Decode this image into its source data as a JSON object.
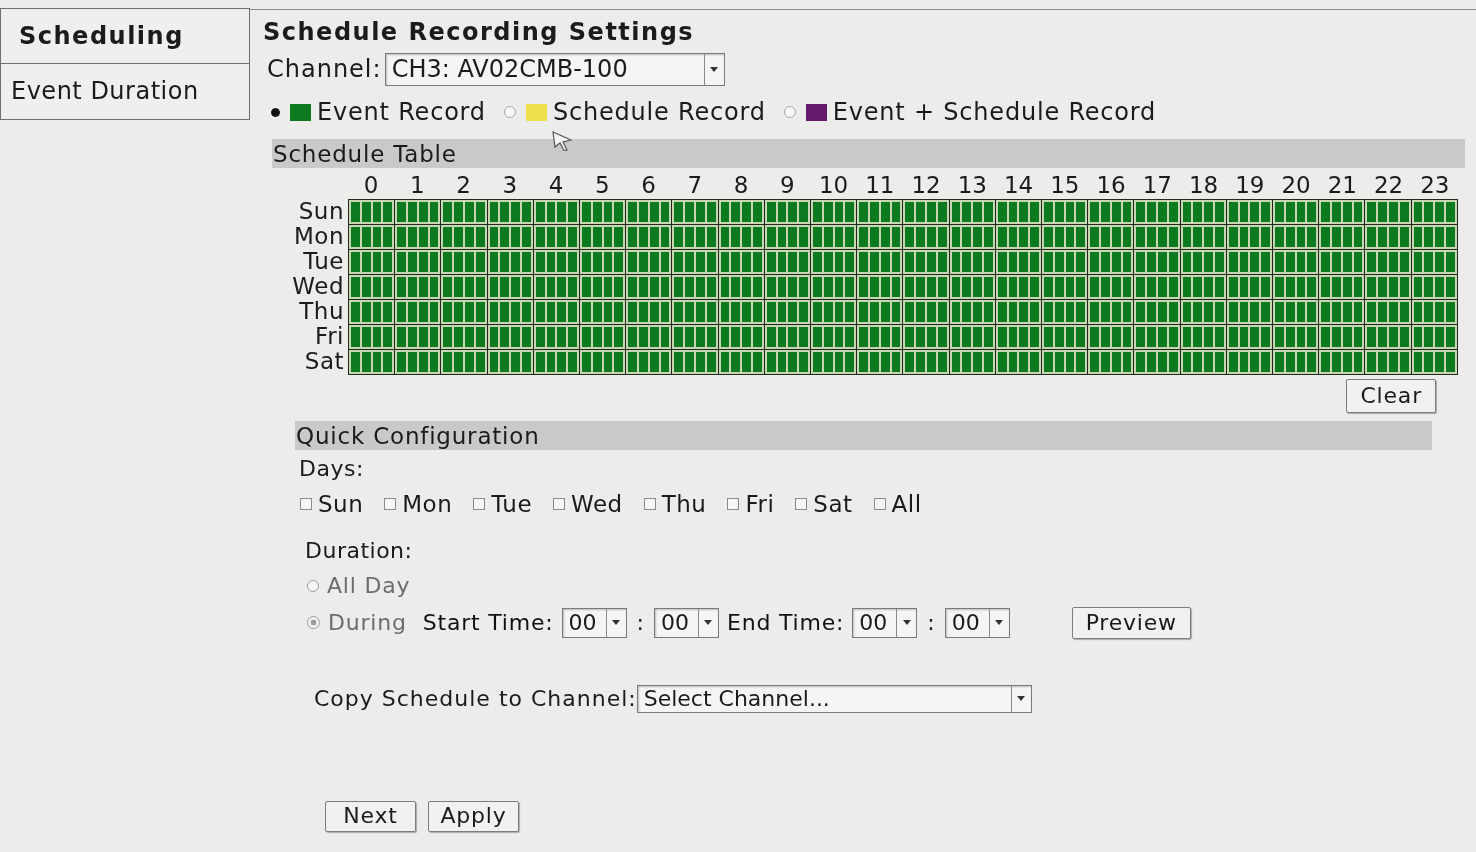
{
  "sidebar": {
    "tabs": [
      {
        "label": "Scheduling",
        "selected": true
      },
      {
        "label": "Event Duration",
        "selected": false
      }
    ]
  },
  "title": "Schedule Recording Settings",
  "channel": {
    "label": "Channel:",
    "value": "CH3: AV02CMB-100"
  },
  "modes": [
    {
      "kind": "event",
      "label": "Event Record",
      "color": "#0d7a1f",
      "selected": true
    },
    {
      "kind": "schedule",
      "label": "Schedule Record",
      "color": "#f0df4c",
      "selected": false
    },
    {
      "kind": "event_schedule",
      "label": "Event + Schedule Record",
      "color": "#651a6b",
      "selected": false
    }
  ],
  "schedule": {
    "title": "Schedule Table",
    "hours": [
      "0",
      "1",
      "2",
      "3",
      "4",
      "5",
      "6",
      "7",
      "8",
      "9",
      "10",
      "11",
      "12",
      "13",
      "14",
      "15",
      "16",
      "17",
      "18",
      "19",
      "20",
      "21",
      "22",
      "23"
    ],
    "days": [
      {
        "label": "Sun",
        "slots": [
          {
            "kind": "event"
          },
          {
            "kind": "event"
          },
          {
            "kind": "event"
          },
          {
            "kind": "event"
          },
          {
            "kind": "event"
          },
          {
            "kind": "event"
          },
          {
            "kind": "event"
          },
          {
            "kind": "event"
          },
          {
            "kind": "event"
          },
          {
            "kind": "event"
          },
          {
            "kind": "event"
          },
          {
            "kind": "event"
          },
          {
            "kind": "event"
          },
          {
            "kind": "event"
          },
          {
            "kind": "event"
          },
          {
            "kind": "event"
          },
          {
            "kind": "event"
          },
          {
            "kind": "event"
          },
          {
            "kind": "event"
          },
          {
            "kind": "event"
          },
          {
            "kind": "event"
          },
          {
            "kind": "event"
          },
          {
            "kind": "event"
          },
          {
            "kind": "event"
          },
          {
            "kind": "event"
          },
          {
            "kind": "event"
          },
          {
            "kind": "event"
          },
          {
            "kind": "event"
          },
          {
            "kind": "event"
          },
          {
            "kind": "event"
          },
          {
            "kind": "event"
          },
          {
            "kind": "event"
          },
          {
            "kind": "event"
          },
          {
            "kind": "event"
          },
          {
            "kind": "event"
          },
          {
            "kind": "event"
          },
          {
            "kind": "event"
          },
          {
            "kind": "event"
          },
          {
            "kind": "event"
          },
          {
            "kind": "event"
          },
          {
            "kind": "event"
          },
          {
            "kind": "event"
          },
          {
            "kind": "event"
          },
          {
            "kind": "event"
          },
          {
            "kind": "event"
          },
          {
            "kind": "event"
          },
          {
            "kind": "event"
          },
          {
            "kind": "event"
          },
          {
            "kind": "event"
          },
          {
            "kind": "event"
          },
          {
            "kind": "event"
          },
          {
            "kind": "event"
          },
          {
            "kind": "event"
          },
          {
            "kind": "event"
          },
          {
            "kind": "event"
          },
          {
            "kind": "event"
          },
          {
            "kind": "event"
          },
          {
            "kind": "event"
          },
          {
            "kind": "event"
          },
          {
            "kind": "event"
          },
          {
            "kind": "event"
          },
          {
            "kind": "event"
          },
          {
            "kind": "event"
          },
          {
            "kind": "event"
          },
          {
            "kind": "event"
          },
          {
            "kind": "event"
          },
          {
            "kind": "event"
          },
          {
            "kind": "event"
          },
          {
            "kind": "event"
          },
          {
            "kind": "event"
          },
          {
            "kind": "event"
          },
          {
            "kind": "event"
          },
          {
            "kind": "event"
          },
          {
            "kind": "event"
          },
          {
            "kind": "event"
          },
          {
            "kind": "event"
          },
          {
            "kind": "event"
          },
          {
            "kind": "event"
          },
          {
            "kind": "event"
          },
          {
            "kind": "event"
          },
          {
            "kind": "event"
          },
          {
            "kind": "event"
          },
          {
            "kind": "event"
          },
          {
            "kind": "event"
          },
          {
            "kind": "event"
          },
          {
            "kind": "event"
          },
          {
            "kind": "event"
          },
          {
            "kind": "event"
          },
          {
            "kind": "event"
          },
          {
            "kind": "event"
          },
          {
            "kind": "event"
          },
          {
            "kind": "event"
          },
          {
            "kind": "event"
          },
          {
            "kind": "event"
          },
          {
            "kind": "event"
          },
          {
            "kind": "event"
          }
        ]
      },
      {
        "label": "Mon",
        "slots": [
          {
            "kind": "event"
          },
          {
            "kind": "event"
          },
          {
            "kind": "event"
          },
          {
            "kind": "event"
          },
          {
            "kind": "event"
          },
          {
            "kind": "event"
          },
          {
            "kind": "event"
          },
          {
            "kind": "event"
          },
          {
            "kind": "event"
          },
          {
            "kind": "event"
          },
          {
            "kind": "event"
          },
          {
            "kind": "event"
          },
          {
            "kind": "event"
          },
          {
            "kind": "event"
          },
          {
            "kind": "event"
          },
          {
            "kind": "event"
          },
          {
            "kind": "event"
          },
          {
            "kind": "event"
          },
          {
            "kind": "event"
          },
          {
            "kind": "event"
          },
          {
            "kind": "event"
          },
          {
            "kind": "event"
          },
          {
            "kind": "event"
          },
          {
            "kind": "event"
          },
          {
            "kind": "event"
          },
          {
            "kind": "event"
          },
          {
            "kind": "event"
          },
          {
            "kind": "event"
          },
          {
            "kind": "event"
          },
          {
            "kind": "event"
          },
          {
            "kind": "event"
          },
          {
            "kind": "event"
          },
          {
            "kind": "event"
          },
          {
            "kind": "event"
          },
          {
            "kind": "event"
          },
          {
            "kind": "event"
          },
          {
            "kind": "event"
          },
          {
            "kind": "event"
          },
          {
            "kind": "event"
          },
          {
            "kind": "event"
          },
          {
            "kind": "event"
          },
          {
            "kind": "event"
          },
          {
            "kind": "event"
          },
          {
            "kind": "event"
          },
          {
            "kind": "event"
          },
          {
            "kind": "event"
          },
          {
            "kind": "event"
          },
          {
            "kind": "event"
          },
          {
            "kind": "event"
          },
          {
            "kind": "event"
          },
          {
            "kind": "event"
          },
          {
            "kind": "event"
          },
          {
            "kind": "event"
          },
          {
            "kind": "event"
          },
          {
            "kind": "event"
          },
          {
            "kind": "event"
          },
          {
            "kind": "event"
          },
          {
            "kind": "event"
          },
          {
            "kind": "event"
          },
          {
            "kind": "event"
          },
          {
            "kind": "event"
          },
          {
            "kind": "event"
          },
          {
            "kind": "event"
          },
          {
            "kind": "event"
          },
          {
            "kind": "event"
          },
          {
            "kind": "event"
          },
          {
            "kind": "event"
          },
          {
            "kind": "event"
          },
          {
            "kind": "event"
          },
          {
            "kind": "event"
          },
          {
            "kind": "event"
          },
          {
            "kind": "event"
          },
          {
            "kind": "event"
          },
          {
            "kind": "event"
          },
          {
            "kind": "event"
          },
          {
            "kind": "event"
          },
          {
            "kind": "event"
          },
          {
            "kind": "event"
          },
          {
            "kind": "event"
          },
          {
            "kind": "event"
          },
          {
            "kind": "event"
          },
          {
            "kind": "event"
          },
          {
            "kind": "event"
          },
          {
            "kind": "event"
          },
          {
            "kind": "event"
          },
          {
            "kind": "event"
          },
          {
            "kind": "event"
          },
          {
            "kind": "event"
          },
          {
            "kind": "event"
          },
          {
            "kind": "event"
          },
          {
            "kind": "event"
          },
          {
            "kind": "event"
          },
          {
            "kind": "event"
          },
          {
            "kind": "event"
          },
          {
            "kind": "event"
          },
          {
            "kind": "event"
          }
        ]
      },
      {
        "label": "Tue",
        "slots": [
          {
            "kind": "event"
          },
          {
            "kind": "event"
          },
          {
            "kind": "event"
          },
          {
            "kind": "event"
          },
          {
            "kind": "event"
          },
          {
            "kind": "event"
          },
          {
            "kind": "event"
          },
          {
            "kind": "event"
          },
          {
            "kind": "event"
          },
          {
            "kind": "event"
          },
          {
            "kind": "event"
          },
          {
            "kind": "event"
          },
          {
            "kind": "event"
          },
          {
            "kind": "event"
          },
          {
            "kind": "event"
          },
          {
            "kind": "event"
          },
          {
            "kind": "event"
          },
          {
            "kind": "event"
          },
          {
            "kind": "event"
          },
          {
            "kind": "event"
          },
          {
            "kind": "event"
          },
          {
            "kind": "event"
          },
          {
            "kind": "event"
          },
          {
            "kind": "event"
          },
          {
            "kind": "event"
          },
          {
            "kind": "event"
          },
          {
            "kind": "event"
          },
          {
            "kind": "event"
          },
          {
            "kind": "event"
          },
          {
            "kind": "event"
          },
          {
            "kind": "event"
          },
          {
            "kind": "event"
          },
          {
            "kind": "event"
          },
          {
            "kind": "event"
          },
          {
            "kind": "event"
          },
          {
            "kind": "event"
          },
          {
            "kind": "event"
          },
          {
            "kind": "event"
          },
          {
            "kind": "event"
          },
          {
            "kind": "event"
          },
          {
            "kind": "event"
          },
          {
            "kind": "event"
          },
          {
            "kind": "event"
          },
          {
            "kind": "event"
          },
          {
            "kind": "event"
          },
          {
            "kind": "event"
          },
          {
            "kind": "event"
          },
          {
            "kind": "event"
          },
          {
            "kind": "event"
          },
          {
            "kind": "event"
          },
          {
            "kind": "event"
          },
          {
            "kind": "event"
          },
          {
            "kind": "event"
          },
          {
            "kind": "event"
          },
          {
            "kind": "event"
          },
          {
            "kind": "event"
          },
          {
            "kind": "event"
          },
          {
            "kind": "event"
          },
          {
            "kind": "event"
          },
          {
            "kind": "event"
          },
          {
            "kind": "event"
          },
          {
            "kind": "event"
          },
          {
            "kind": "event"
          },
          {
            "kind": "event"
          },
          {
            "kind": "event"
          },
          {
            "kind": "event"
          },
          {
            "kind": "event"
          },
          {
            "kind": "event"
          },
          {
            "kind": "event"
          },
          {
            "kind": "event"
          },
          {
            "kind": "event"
          },
          {
            "kind": "event"
          },
          {
            "kind": "event"
          },
          {
            "kind": "event"
          },
          {
            "kind": "event"
          },
          {
            "kind": "event"
          },
          {
            "kind": "event"
          },
          {
            "kind": "event"
          },
          {
            "kind": "event"
          },
          {
            "kind": "event"
          },
          {
            "kind": "event"
          },
          {
            "kind": "event"
          },
          {
            "kind": "event"
          },
          {
            "kind": "event"
          },
          {
            "kind": "event"
          },
          {
            "kind": "event"
          },
          {
            "kind": "event"
          },
          {
            "kind": "event"
          },
          {
            "kind": "event"
          },
          {
            "kind": "event"
          },
          {
            "kind": "event"
          },
          {
            "kind": "event"
          },
          {
            "kind": "event"
          },
          {
            "kind": "event"
          },
          {
            "kind": "event"
          },
          {
            "kind": "event"
          }
        ]
      },
      {
        "label": "Wed",
        "slots": [
          {
            "kind": "event"
          },
          {
            "kind": "event"
          },
          {
            "kind": "event"
          },
          {
            "kind": "event"
          },
          {
            "kind": "event"
          },
          {
            "kind": "event"
          },
          {
            "kind": "event"
          },
          {
            "kind": "event"
          },
          {
            "kind": "event"
          },
          {
            "kind": "event"
          },
          {
            "kind": "event"
          },
          {
            "kind": "event"
          },
          {
            "kind": "event"
          },
          {
            "kind": "event"
          },
          {
            "kind": "event"
          },
          {
            "kind": "event"
          },
          {
            "kind": "event"
          },
          {
            "kind": "event"
          },
          {
            "kind": "event"
          },
          {
            "kind": "event"
          },
          {
            "kind": "event"
          },
          {
            "kind": "event"
          },
          {
            "kind": "event"
          },
          {
            "kind": "event"
          },
          {
            "kind": "event"
          },
          {
            "kind": "event"
          },
          {
            "kind": "event"
          },
          {
            "kind": "event"
          },
          {
            "kind": "event"
          },
          {
            "kind": "event"
          },
          {
            "kind": "event"
          },
          {
            "kind": "event"
          },
          {
            "kind": "event"
          },
          {
            "kind": "event"
          },
          {
            "kind": "event"
          },
          {
            "kind": "event"
          },
          {
            "kind": "event"
          },
          {
            "kind": "event"
          },
          {
            "kind": "event"
          },
          {
            "kind": "event"
          },
          {
            "kind": "event"
          },
          {
            "kind": "event"
          },
          {
            "kind": "event"
          },
          {
            "kind": "event"
          },
          {
            "kind": "event"
          },
          {
            "kind": "event"
          },
          {
            "kind": "event"
          },
          {
            "kind": "event"
          },
          {
            "kind": "event"
          },
          {
            "kind": "event"
          },
          {
            "kind": "event"
          },
          {
            "kind": "event"
          },
          {
            "kind": "event"
          },
          {
            "kind": "event"
          },
          {
            "kind": "event"
          },
          {
            "kind": "event"
          },
          {
            "kind": "event"
          },
          {
            "kind": "event"
          },
          {
            "kind": "event"
          },
          {
            "kind": "event"
          },
          {
            "kind": "event"
          },
          {
            "kind": "event"
          },
          {
            "kind": "event"
          },
          {
            "kind": "event"
          },
          {
            "kind": "event"
          },
          {
            "kind": "event"
          },
          {
            "kind": "event"
          },
          {
            "kind": "event"
          },
          {
            "kind": "event"
          },
          {
            "kind": "event"
          },
          {
            "kind": "event"
          },
          {
            "kind": "event"
          },
          {
            "kind": "event"
          },
          {
            "kind": "event"
          },
          {
            "kind": "event"
          },
          {
            "kind": "event"
          },
          {
            "kind": "event"
          },
          {
            "kind": "event"
          },
          {
            "kind": "event"
          },
          {
            "kind": "event"
          },
          {
            "kind": "event"
          },
          {
            "kind": "event"
          },
          {
            "kind": "event"
          },
          {
            "kind": "event"
          },
          {
            "kind": "event"
          },
          {
            "kind": "event"
          },
          {
            "kind": "event"
          },
          {
            "kind": "event"
          },
          {
            "kind": "event"
          },
          {
            "kind": "event"
          },
          {
            "kind": "event"
          },
          {
            "kind": "event"
          },
          {
            "kind": "event"
          },
          {
            "kind": "event"
          },
          {
            "kind": "event"
          },
          {
            "kind": "event"
          }
        ]
      },
      {
        "label": "Thu",
        "slots": [
          {
            "kind": "event"
          },
          {
            "kind": "event"
          },
          {
            "kind": "event"
          },
          {
            "kind": "event"
          },
          {
            "kind": "event"
          },
          {
            "kind": "event"
          },
          {
            "kind": "event"
          },
          {
            "kind": "event"
          },
          {
            "kind": "event"
          },
          {
            "kind": "event"
          },
          {
            "kind": "event"
          },
          {
            "kind": "event"
          },
          {
            "kind": "event"
          },
          {
            "kind": "event"
          },
          {
            "kind": "event"
          },
          {
            "kind": "event"
          },
          {
            "kind": "event"
          },
          {
            "kind": "event"
          },
          {
            "kind": "event"
          },
          {
            "kind": "event"
          },
          {
            "kind": "event"
          },
          {
            "kind": "event"
          },
          {
            "kind": "event"
          },
          {
            "kind": "event"
          },
          {
            "kind": "event"
          },
          {
            "kind": "event"
          },
          {
            "kind": "event"
          },
          {
            "kind": "event"
          },
          {
            "kind": "event"
          },
          {
            "kind": "event"
          },
          {
            "kind": "event"
          },
          {
            "kind": "event"
          },
          {
            "kind": "event"
          },
          {
            "kind": "event"
          },
          {
            "kind": "event"
          },
          {
            "kind": "event"
          },
          {
            "kind": "event"
          },
          {
            "kind": "event"
          },
          {
            "kind": "event"
          },
          {
            "kind": "event"
          },
          {
            "kind": "event"
          },
          {
            "kind": "event"
          },
          {
            "kind": "event"
          },
          {
            "kind": "event"
          },
          {
            "kind": "event"
          },
          {
            "kind": "event"
          },
          {
            "kind": "event"
          },
          {
            "kind": "event"
          },
          {
            "kind": "event"
          },
          {
            "kind": "event"
          },
          {
            "kind": "event"
          },
          {
            "kind": "event"
          },
          {
            "kind": "event"
          },
          {
            "kind": "event"
          },
          {
            "kind": "event"
          },
          {
            "kind": "event"
          },
          {
            "kind": "event"
          },
          {
            "kind": "event"
          },
          {
            "kind": "event"
          },
          {
            "kind": "event"
          },
          {
            "kind": "event"
          },
          {
            "kind": "event"
          },
          {
            "kind": "event"
          },
          {
            "kind": "event"
          },
          {
            "kind": "event"
          },
          {
            "kind": "event"
          },
          {
            "kind": "event"
          },
          {
            "kind": "event"
          },
          {
            "kind": "event"
          },
          {
            "kind": "event"
          },
          {
            "kind": "event"
          },
          {
            "kind": "event"
          },
          {
            "kind": "event"
          },
          {
            "kind": "event"
          },
          {
            "kind": "event"
          },
          {
            "kind": "event"
          },
          {
            "kind": "event"
          },
          {
            "kind": "event"
          },
          {
            "kind": "event"
          },
          {
            "kind": "event"
          },
          {
            "kind": "event"
          },
          {
            "kind": "event"
          },
          {
            "kind": "event"
          },
          {
            "kind": "event"
          },
          {
            "kind": "event"
          },
          {
            "kind": "event"
          },
          {
            "kind": "event"
          },
          {
            "kind": "event"
          },
          {
            "kind": "event"
          },
          {
            "kind": "event"
          },
          {
            "kind": "event"
          },
          {
            "kind": "event"
          },
          {
            "kind": "event"
          },
          {
            "kind": "event"
          },
          {
            "kind": "event"
          },
          {
            "kind": "event"
          }
        ]
      },
      {
        "label": "Fri",
        "slots": [
          {
            "kind": "event"
          },
          {
            "kind": "event"
          },
          {
            "kind": "event"
          },
          {
            "kind": "event"
          },
          {
            "kind": "event"
          },
          {
            "kind": "event"
          },
          {
            "kind": "event"
          },
          {
            "kind": "event"
          },
          {
            "kind": "event"
          },
          {
            "kind": "event"
          },
          {
            "kind": "event"
          },
          {
            "kind": "event"
          },
          {
            "kind": "event"
          },
          {
            "kind": "event"
          },
          {
            "kind": "event"
          },
          {
            "kind": "event"
          },
          {
            "kind": "event"
          },
          {
            "kind": "event"
          },
          {
            "kind": "event"
          },
          {
            "kind": "event"
          },
          {
            "kind": "event"
          },
          {
            "kind": "event"
          },
          {
            "kind": "event"
          },
          {
            "kind": "event"
          },
          {
            "kind": "event"
          },
          {
            "kind": "event"
          },
          {
            "kind": "event"
          },
          {
            "kind": "event"
          },
          {
            "kind": "event"
          },
          {
            "kind": "event"
          },
          {
            "kind": "event"
          },
          {
            "kind": "event"
          },
          {
            "kind": "event"
          },
          {
            "kind": "event"
          },
          {
            "kind": "event"
          },
          {
            "kind": "event"
          },
          {
            "kind": "event"
          },
          {
            "kind": "event"
          },
          {
            "kind": "event"
          },
          {
            "kind": "event"
          },
          {
            "kind": "event"
          },
          {
            "kind": "event"
          },
          {
            "kind": "event"
          },
          {
            "kind": "event"
          },
          {
            "kind": "event"
          },
          {
            "kind": "event"
          },
          {
            "kind": "event"
          },
          {
            "kind": "event"
          },
          {
            "kind": "event"
          },
          {
            "kind": "event"
          },
          {
            "kind": "event"
          },
          {
            "kind": "event"
          },
          {
            "kind": "event"
          },
          {
            "kind": "event"
          },
          {
            "kind": "event"
          },
          {
            "kind": "event"
          },
          {
            "kind": "event"
          },
          {
            "kind": "event"
          },
          {
            "kind": "event"
          },
          {
            "kind": "event"
          },
          {
            "kind": "event"
          },
          {
            "kind": "event"
          },
          {
            "kind": "event"
          },
          {
            "kind": "event"
          },
          {
            "kind": "event"
          },
          {
            "kind": "event"
          },
          {
            "kind": "event"
          },
          {
            "kind": "event"
          },
          {
            "kind": "event"
          },
          {
            "kind": "event"
          },
          {
            "kind": "event"
          },
          {
            "kind": "event"
          },
          {
            "kind": "event"
          },
          {
            "kind": "event"
          },
          {
            "kind": "event"
          },
          {
            "kind": "event"
          },
          {
            "kind": "event"
          },
          {
            "kind": "event"
          },
          {
            "kind": "event"
          },
          {
            "kind": "event"
          },
          {
            "kind": "event"
          },
          {
            "kind": "event"
          },
          {
            "kind": "event"
          },
          {
            "kind": "event"
          },
          {
            "kind": "event"
          },
          {
            "kind": "event"
          },
          {
            "kind": "event"
          },
          {
            "kind": "event"
          },
          {
            "kind": "event"
          },
          {
            "kind": "event"
          },
          {
            "kind": "event"
          },
          {
            "kind": "event"
          },
          {
            "kind": "event"
          },
          {
            "kind": "event"
          },
          {
            "kind": "event"
          },
          {
            "kind": "event"
          }
        ]
      },
      {
        "label": "Sat",
        "slots": [
          {
            "kind": "event"
          },
          {
            "kind": "event"
          },
          {
            "kind": "event"
          },
          {
            "kind": "event"
          },
          {
            "kind": "event"
          },
          {
            "kind": "event"
          },
          {
            "kind": "event"
          },
          {
            "kind": "event"
          },
          {
            "kind": "event"
          },
          {
            "kind": "event"
          },
          {
            "kind": "event"
          },
          {
            "kind": "event"
          },
          {
            "kind": "event"
          },
          {
            "kind": "event"
          },
          {
            "kind": "event"
          },
          {
            "kind": "event"
          },
          {
            "kind": "event"
          },
          {
            "kind": "event"
          },
          {
            "kind": "event"
          },
          {
            "kind": "event"
          },
          {
            "kind": "event"
          },
          {
            "kind": "event"
          },
          {
            "kind": "event"
          },
          {
            "kind": "event"
          },
          {
            "kind": "event"
          },
          {
            "kind": "event"
          },
          {
            "kind": "event"
          },
          {
            "kind": "event"
          },
          {
            "kind": "event"
          },
          {
            "kind": "event"
          },
          {
            "kind": "event"
          },
          {
            "kind": "event"
          },
          {
            "kind": "event"
          },
          {
            "kind": "event"
          },
          {
            "kind": "event"
          },
          {
            "kind": "event"
          },
          {
            "kind": "event"
          },
          {
            "kind": "event"
          },
          {
            "kind": "event"
          },
          {
            "kind": "event"
          },
          {
            "kind": "event"
          },
          {
            "kind": "event"
          },
          {
            "kind": "event"
          },
          {
            "kind": "event"
          },
          {
            "kind": "event"
          },
          {
            "kind": "event"
          },
          {
            "kind": "event"
          },
          {
            "kind": "event"
          },
          {
            "kind": "event"
          },
          {
            "kind": "event"
          },
          {
            "kind": "event"
          },
          {
            "kind": "event"
          },
          {
            "kind": "event"
          },
          {
            "kind": "event"
          },
          {
            "kind": "event"
          },
          {
            "kind": "event"
          },
          {
            "kind": "event"
          },
          {
            "kind": "event"
          },
          {
            "kind": "event"
          },
          {
            "kind": "event"
          },
          {
            "kind": "event"
          },
          {
            "kind": "event"
          },
          {
            "kind": "event"
          },
          {
            "kind": "event"
          },
          {
            "kind": "event"
          },
          {
            "kind": "event"
          },
          {
            "kind": "event"
          },
          {
            "kind": "event"
          },
          {
            "kind": "event"
          },
          {
            "kind": "event"
          },
          {
            "kind": "event"
          },
          {
            "kind": "event"
          },
          {
            "kind": "event"
          },
          {
            "kind": "event"
          },
          {
            "kind": "event"
          },
          {
            "kind": "event"
          },
          {
            "kind": "event"
          },
          {
            "kind": "event"
          },
          {
            "kind": "event"
          },
          {
            "kind": "event"
          },
          {
            "kind": "event"
          },
          {
            "kind": "event"
          },
          {
            "kind": "event"
          },
          {
            "kind": "event"
          },
          {
            "kind": "event"
          },
          {
            "kind": "event"
          },
          {
            "kind": "event"
          },
          {
            "kind": "event"
          },
          {
            "kind": "event"
          },
          {
            "kind": "event"
          },
          {
            "kind": "event"
          },
          {
            "kind": "event"
          },
          {
            "kind": "event"
          },
          {
            "kind": "event"
          },
          {
            "kind": "event"
          },
          {
            "kind": "event"
          }
        ]
      }
    ],
    "clear_button": "Clear"
  },
  "quick_config": {
    "title": "Quick Configuration",
    "days_label": "Days:",
    "days": [
      {
        "label": "Sun",
        "checked": false
      },
      {
        "label": "Mon",
        "checked": false
      },
      {
        "label": "Tue",
        "checked": false
      },
      {
        "label": "Wed",
        "checked": false
      },
      {
        "label": "Thu",
        "checked": false
      },
      {
        "label": "Fri",
        "checked": false
      },
      {
        "label": "Sat",
        "checked": false
      },
      {
        "label": "All",
        "checked": false
      }
    ],
    "duration_label": "Duration:",
    "duration_options": [
      {
        "label": "All Day",
        "selected": false,
        "disabled": true
      },
      {
        "label": "During",
        "selected": true,
        "disabled": true
      }
    ],
    "start_time": {
      "label": "Start Time:",
      "hour": "00",
      "separator": ":",
      "minute": "00"
    },
    "end_time": {
      "label": "End Time:",
      "hour": "00",
      "separator": ":",
      "minute": "00"
    },
    "preview_button": "Preview"
  },
  "copy": {
    "label": "Copy Schedule to Channel:",
    "value": "Select Channel..."
  },
  "buttons": [
    "Next",
    "Apply"
  ]
}
